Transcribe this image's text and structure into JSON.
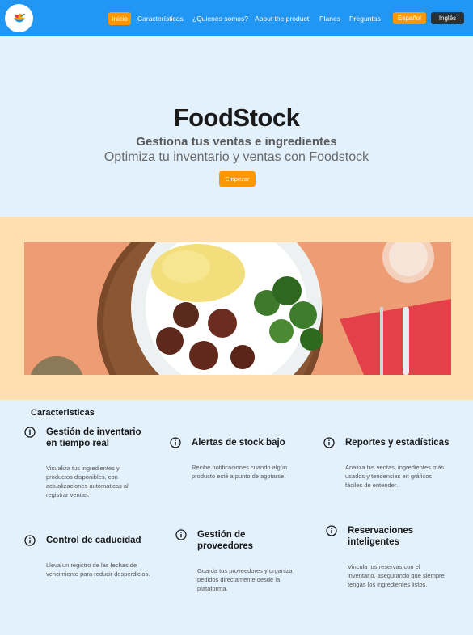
{
  "nav": {
    "logo_icon": "bowl-logo-icon",
    "links": [
      "Inicio",
      "Características",
      "¿Quienés somos?",
      "About the product",
      "Planes",
      "Preguntas"
    ],
    "lang_es": "Español",
    "lang_en": "Inglés"
  },
  "hero": {
    "title": "FoodStock",
    "subtitle": "Gestiona tus ventas e ingredientes",
    "description": "Optimiza tu inventario y ventas con Foodstock",
    "cta": "Empezar"
  },
  "features": {
    "section_title": "Caracteristicas",
    "icon": "info-circle-icon",
    "items": [
      {
        "title": "Gestión de inventario en tiempo real",
        "desc": "Visualiza tus ingredientes y productos disponibles, con actualizaciones automáticas al registrar ventas."
      },
      {
        "title": "Alertas de stock bajo",
        "desc": "Recibe notificaciones cuando algún producto esté a punto de agotarse."
      },
      {
        "title": "Reportes y estadísticas",
        "desc": "Analiza tus ventas, ingredientes más usados y tendencias en gráficos fáciles de entender."
      },
      {
        "title": "Control de caducidad",
        "desc": "Lleva un registro de las fechas de vencimiento para reducir desperdicios."
      },
      {
        "title": "Gestión de proveedores",
        "desc": "Guarda tus proveedores y organiza pedidos directamente desde la plataforma."
      },
      {
        "title": "Reservaciones inteligentes",
        "desc": "Vincula tus reservas con el inventario, asegurando que siempre tengas los ingredientes listos."
      }
    ]
  },
  "colors": {
    "nav_bg": "#2196f3",
    "accent": "#ff9800",
    "page_bg": "#e3f1fd",
    "banner_bg": "#ffdfb0"
  }
}
